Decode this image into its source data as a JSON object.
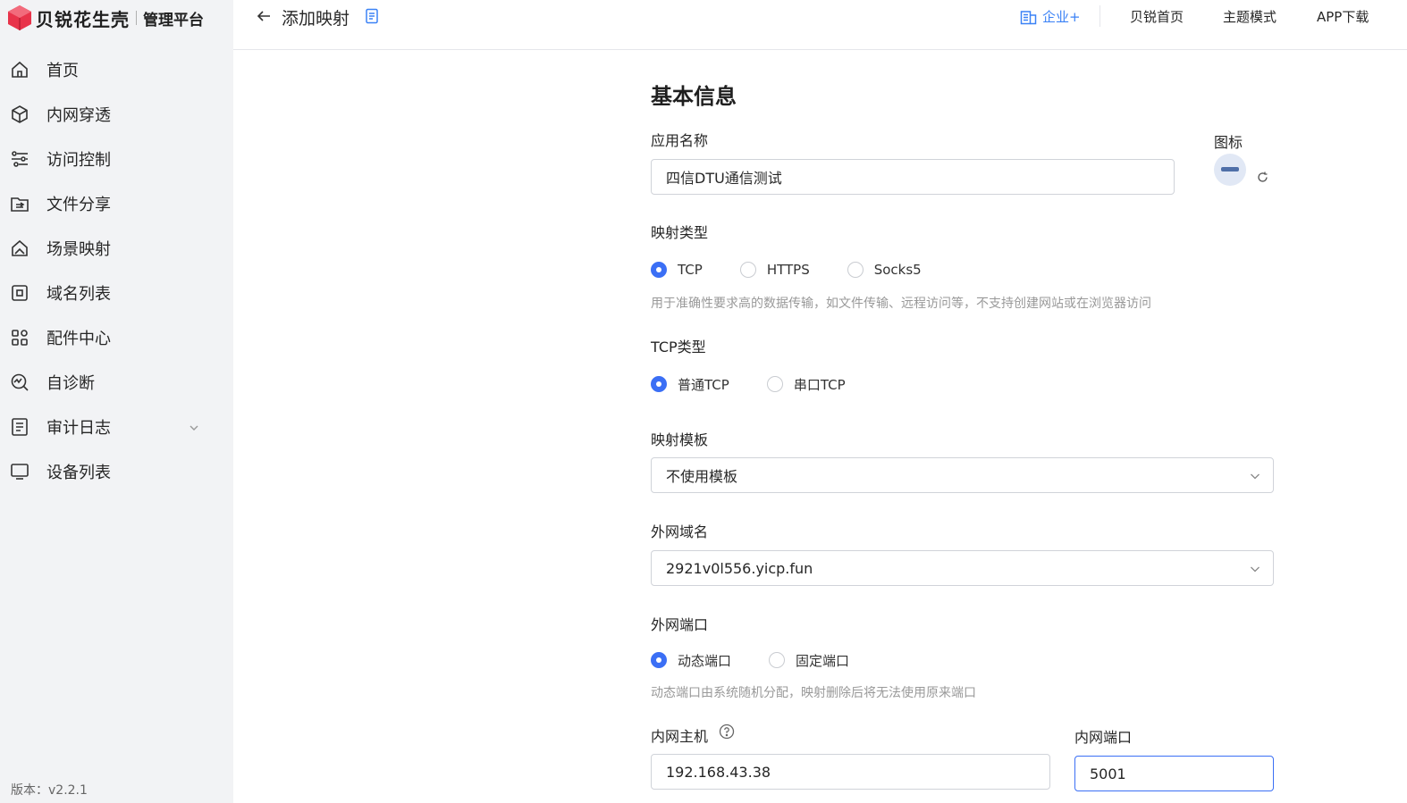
{
  "brand": {
    "name": "贝锐花生壳",
    "subtitle": "管理平台"
  },
  "sidebar": {
    "items": [
      {
        "label": "首页",
        "icon": "home-icon"
      },
      {
        "label": "内网穿透",
        "icon": "cube-icon"
      },
      {
        "label": "访问控制",
        "icon": "sliders-icon"
      },
      {
        "label": "文件分享",
        "icon": "folder-share-icon"
      },
      {
        "label": "场景映射",
        "icon": "scene-icon"
      },
      {
        "label": "域名列表",
        "icon": "domain-icon"
      },
      {
        "label": "配件中心",
        "icon": "grid-icon"
      },
      {
        "label": "自诊断",
        "icon": "diagnosis-icon"
      },
      {
        "label": "审计日志",
        "icon": "log-icon"
      },
      {
        "label": "设备列表",
        "icon": "monitor-icon"
      }
    ],
    "version": "版本：v2.2.1"
  },
  "header": {
    "title": "添加映射",
    "enterprise": "企业+",
    "links": [
      "贝锐首页",
      "主题模式",
      "APP下载"
    ]
  },
  "form": {
    "section_title": "基本信息",
    "app_name_label": "应用名称",
    "app_name_value": "四信DTU通信测试",
    "icon_label": "图标",
    "mapping_type_label": "映射类型",
    "mapping_types": [
      "TCP",
      "HTTPS",
      "Socks5"
    ],
    "mapping_type_selected": "TCP",
    "mapping_type_hint": "用于准确性要求高的数据传输，如文件传输、远程访问等，不支持创建网站或在浏览器访问",
    "tcp_type_label": "TCP类型",
    "tcp_types": [
      "普通TCP",
      "串口TCP"
    ],
    "tcp_type_selected": "普通TCP",
    "template_label": "映射模板",
    "template_value": "不使用模板",
    "domain_label": "外网域名",
    "domain_value": "2921v0l556.yicp.fun",
    "port_label": "外网端口",
    "port_types": [
      "动态端口",
      "固定端口"
    ],
    "port_type_selected": "动态端口",
    "port_hint": "动态端口由系统随机分配，映射删除后将无法使用原来端口",
    "host_label": "内网主机",
    "host_value": "192.168.43.38",
    "lan_port_label": "内网端口",
    "lan_port_value": "5001"
  },
  "colors": {
    "accent": "#3b6ff5",
    "link_blue": "#3b82f6",
    "sidebar_bg": "#f2f3f5",
    "logo_red": "#e8334a"
  }
}
